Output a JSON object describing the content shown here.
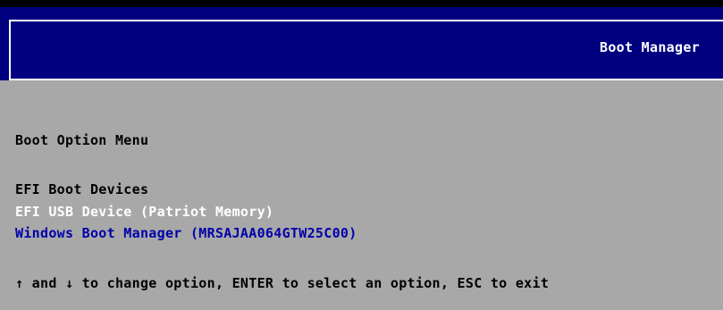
{
  "header": {
    "title": "Boot Manager"
  },
  "menu": {
    "heading": "Boot Option Menu",
    "group_label": "EFI Boot Devices",
    "options": [
      {
        "label": "EFI USB Device (Patriot Memory)",
        "state": "selected"
      },
      {
        "label": "Windows Boot Manager (MRSAJAA064GTW25C00)",
        "state": "normal"
      }
    ]
  },
  "help": {
    "text": "↑ and ↓ to change option, ENTER to select an option, ESC to exit"
  },
  "colors": {
    "header_bg": "#000080",
    "body_bg": "#a8a8a8",
    "selected_text": "#ffffff",
    "option_text": "#0000a8",
    "static_text": "#000000"
  }
}
